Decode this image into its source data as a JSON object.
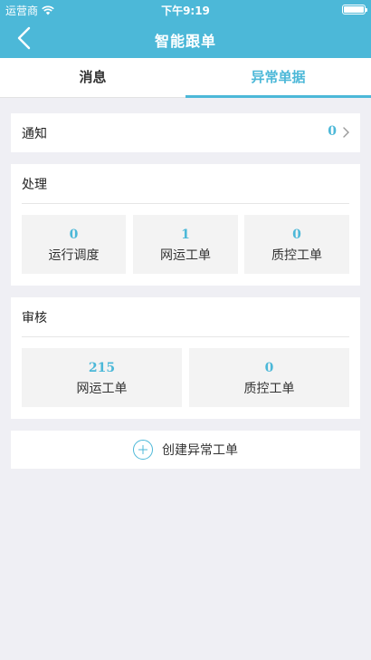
{
  "status_bar": {
    "carrier": "运营商",
    "time": "下午9:19"
  },
  "nav": {
    "title": "智能跟单"
  },
  "tabs": [
    {
      "label": "消息",
      "active": false
    },
    {
      "label": "异常单据",
      "active": true
    }
  ],
  "notice": {
    "label": "通知",
    "count": "0"
  },
  "handle": {
    "title": "处理",
    "items": [
      {
        "count": "0",
        "label": "运行调度"
      },
      {
        "count": "1",
        "label": "网运工单"
      },
      {
        "count": "0",
        "label": "质控工单"
      }
    ]
  },
  "review": {
    "title": "审核",
    "items": [
      {
        "count": "215",
        "label": "网运工单"
      },
      {
        "count": "0",
        "label": "质控工单"
      }
    ]
  },
  "create": {
    "label": "创建异常工单"
  },
  "colors": {
    "accent": "#4cb8d8",
    "background": "#efeff4",
    "cell": "#f3f3f3"
  },
  "icons": [
    "wifi-icon",
    "battery-icon",
    "back-arrow-icon",
    "chevron-right-icon",
    "plus-circle-icon"
  ]
}
